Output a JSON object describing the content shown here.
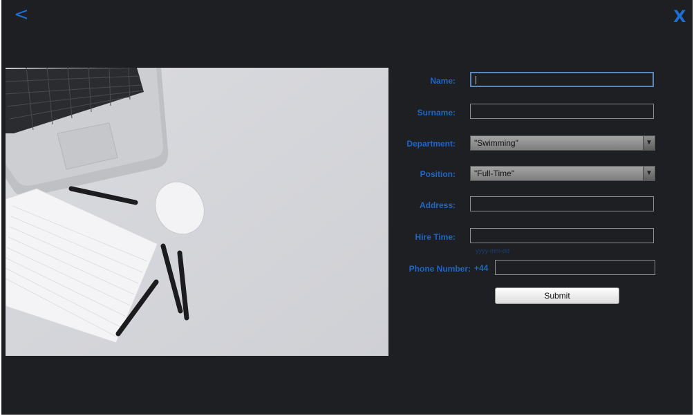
{
  "header": {
    "back_glyph": "<",
    "close_glyph": "X"
  },
  "form": {
    "name_label": "Name:",
    "surname_label": "Surname:",
    "department_label": "Department:",
    "department_value": "\"Swimming\"",
    "position_label": "Position:",
    "position_value": "\"Full-Time\"",
    "address_label": "Address:",
    "hire_time_label": "Hire Time:",
    "hire_time_hint": "yyyy-mm-dd",
    "phone_label": "Phone Number:",
    "phone_prefix": "+44",
    "submit_label": "Submit"
  },
  "colors": {
    "accent": "#1f66c9",
    "window_bg": "#1e1f22"
  }
}
